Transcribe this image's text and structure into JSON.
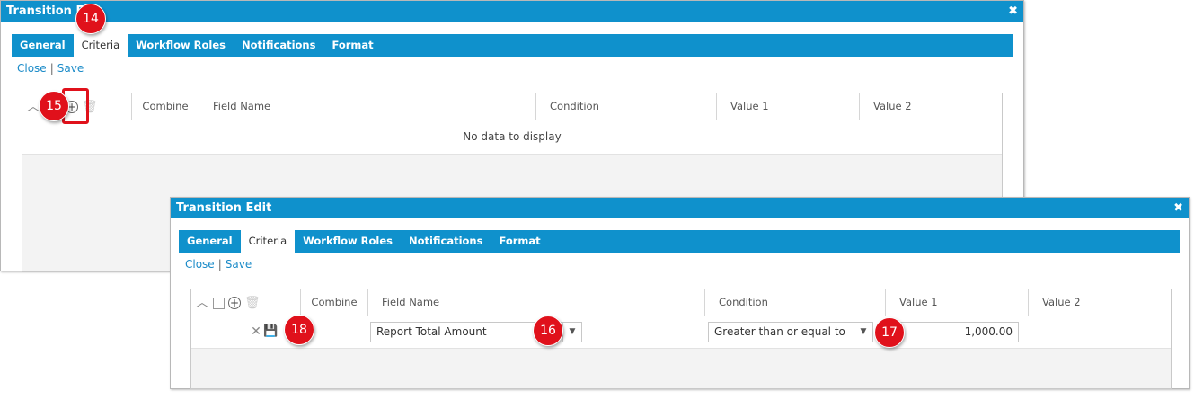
{
  "dialog_back": {
    "title": "Transition Edit",
    "tabs": [
      "General",
      "Criteria",
      "Workflow Roles",
      "Notifications",
      "Format"
    ],
    "active_tab": "Criteria",
    "links": {
      "close": "Close",
      "save": "Save",
      "separator": "|"
    },
    "grid": {
      "columns": [
        "Combine",
        "Field Name",
        "Condition",
        "Value 1",
        "Value 2"
      ],
      "empty_text": "No data to display"
    }
  },
  "dialog_front": {
    "title": "Transition Edit",
    "tabs": [
      "General",
      "Criteria",
      "Workflow Roles",
      "Notifications",
      "Format"
    ],
    "active_tab": "Criteria",
    "links": {
      "close": "Close",
      "save": "Save",
      "separator": "|"
    },
    "grid": {
      "columns": [
        "Combine",
        "Field Name",
        "Condition",
        "Value 1",
        "Value 2"
      ],
      "row": {
        "field_name": "Report Total Amount",
        "condition": "Greater than or equal to",
        "value1": "1,000.00"
      }
    }
  },
  "icons": {
    "close": "close-x-icon",
    "collapse": "chevron-up-icon",
    "add": "plus-circle-icon",
    "delete": "trash-icon",
    "cancel_row": "x-icon",
    "save_row": "floppy-disk-icon",
    "dropdown": "caret-down-icon"
  },
  "callouts": [
    "14",
    "15",
    "16",
    "17",
    "18"
  ],
  "colors": {
    "header_blue": "#0f91cc",
    "callout_red": "#e0111b",
    "link_blue": "#1b8bc8"
  }
}
